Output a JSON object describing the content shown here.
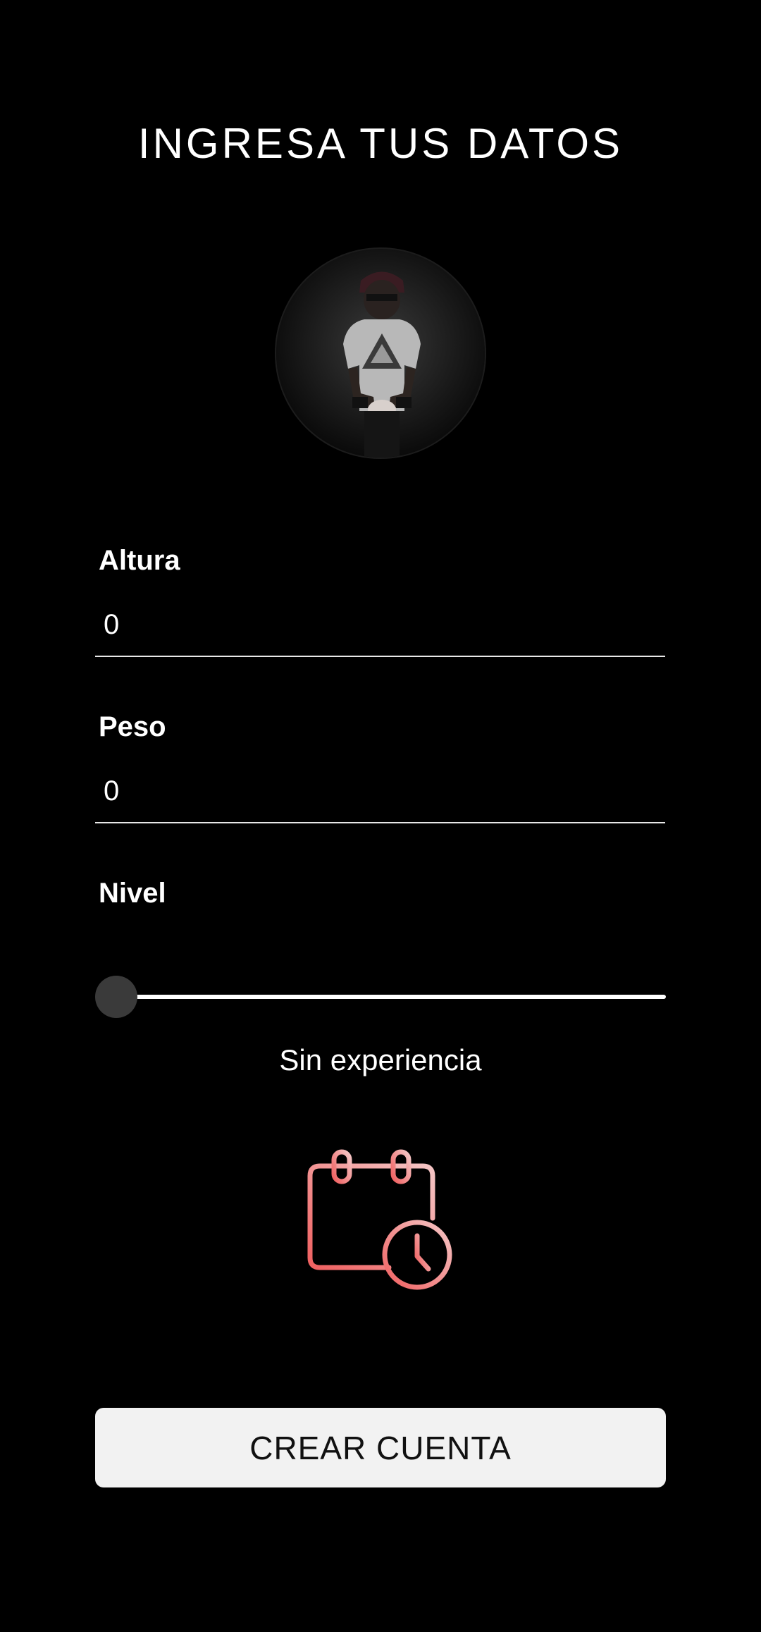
{
  "header": {
    "title": "INGRESA TUS DATOS"
  },
  "profile": {
    "avatar_icon": "person-photo"
  },
  "form": {
    "height": {
      "label": "Altura",
      "value": "0"
    },
    "weight": {
      "label": "Peso",
      "value": "0"
    },
    "level": {
      "label": "Nivel",
      "slider_value": 0,
      "value_text": "Sin experiencia"
    }
  },
  "illustration": {
    "icon": "calendar-clock-icon",
    "gradient": [
      "#f06060",
      "#f5c6c6"
    ]
  },
  "actions": {
    "create_label": "CREAR CUENTA"
  },
  "colors": {
    "background": "#000000",
    "text": "#ffffff",
    "button_bg": "#f2f2f2",
    "button_text": "#111111",
    "slider_thumb": "#3a3a3a"
  }
}
